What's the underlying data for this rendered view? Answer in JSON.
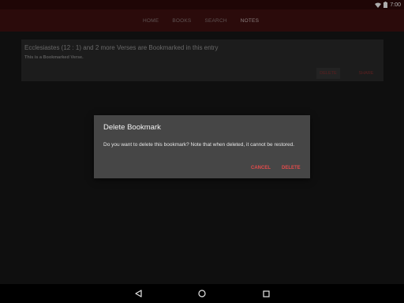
{
  "status_bar": {
    "time": "7:00",
    "icons": [
      "wifi-icon",
      "battery-icon"
    ]
  },
  "nav_tabs": [
    {
      "label": "HOME",
      "active": false
    },
    {
      "label": "BOOKS",
      "active": false
    },
    {
      "label": "SEARCH",
      "active": false
    },
    {
      "label": "NOTES",
      "active": true
    }
  ],
  "bookmark_card": {
    "title": "Ecclesiastes (12 : 1) and 2 more Verses are Bookmarked in this entry",
    "note": "This is a Bookmarked Verse.",
    "delete_label": "DELETE",
    "share_label": "SHARE"
  },
  "dialog": {
    "title": "Delete Bookmark",
    "message": "Do you want to delete this bookmark? Note that when deleted, it cannot be restored.",
    "cancel_label": "CANCEL",
    "confirm_label": "DELETE"
  },
  "nav_bar": {
    "icons": [
      "back-icon",
      "home-icon",
      "recents-icon"
    ]
  },
  "colors": {
    "accent": "#e24b4b",
    "app_bar": "#3a0f0f",
    "status_bar": "#2a0808",
    "dialog_bg": "#464646"
  }
}
